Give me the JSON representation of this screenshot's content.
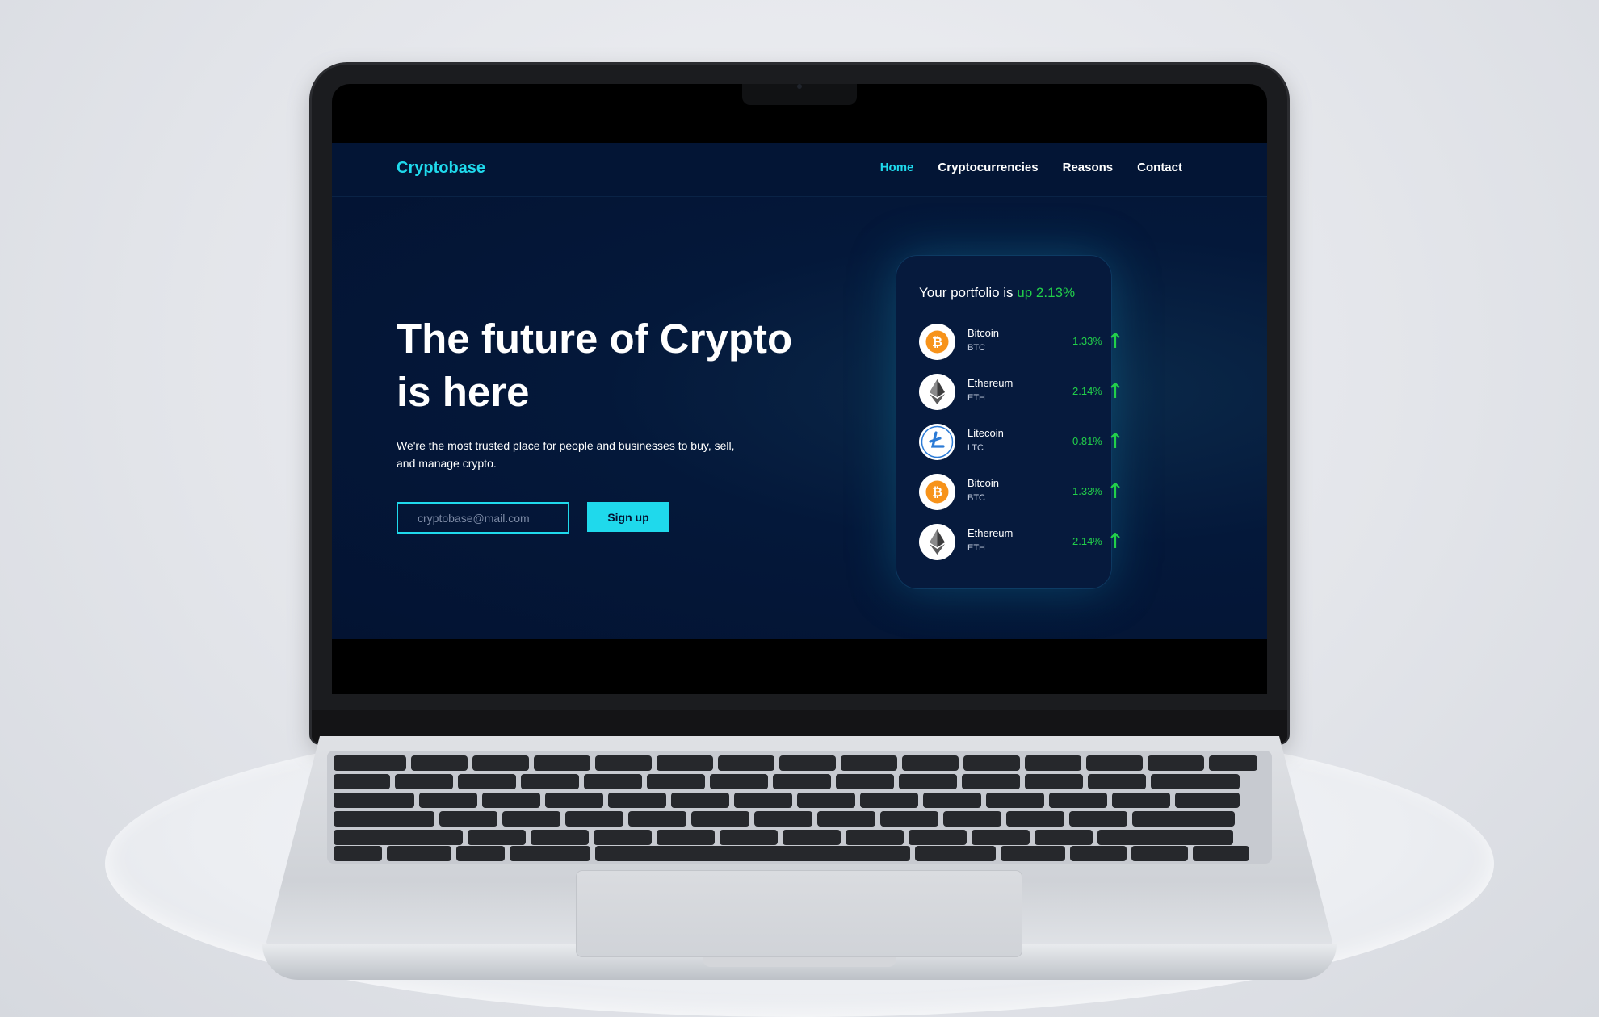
{
  "site": {
    "logo": "Cryptobase",
    "nav": [
      {
        "label": "Home",
        "active": true
      },
      {
        "label": "Cryptocurrencies",
        "active": false
      },
      {
        "label": "Reasons",
        "active": false
      },
      {
        "label": "Contact",
        "active": false
      }
    ],
    "hero": {
      "title_line1": "The future of Crypto",
      "title_line2": "is here",
      "subtitle_line1": "We're the most trusted place for people and businesses to buy, sell,",
      "subtitle_line2": "and manage crypto."
    },
    "signup": {
      "placeholder": "cryptobase@mail.com",
      "button_label": "Sign up"
    },
    "portfolio": {
      "title_prefix": "Your portfolio is",
      "title_change": "up 2.13%",
      "coins": [
        {
          "name": "Bitcoin",
          "symbol": "BTC",
          "change": "1.33%",
          "icon": "bitcoin-icon"
        },
        {
          "name": "Ethereum",
          "symbol": "ETH",
          "change": "2.14%",
          "icon": "ethereum-icon"
        },
        {
          "name": "Litecoin",
          "symbol": "LTC",
          "change": "0.81%",
          "icon": "litecoin-icon"
        },
        {
          "name": "Bitcoin",
          "symbol": "BTC",
          "change": "1.33%",
          "icon": "bitcoin-icon"
        },
        {
          "name": "Ethereum",
          "symbol": "ETH",
          "change": "2.14%",
          "icon": "ethereum-icon"
        }
      ]
    }
  },
  "colors": {
    "accent": "#1fd9ec",
    "background": "#031332",
    "positive": "#22d04a"
  }
}
